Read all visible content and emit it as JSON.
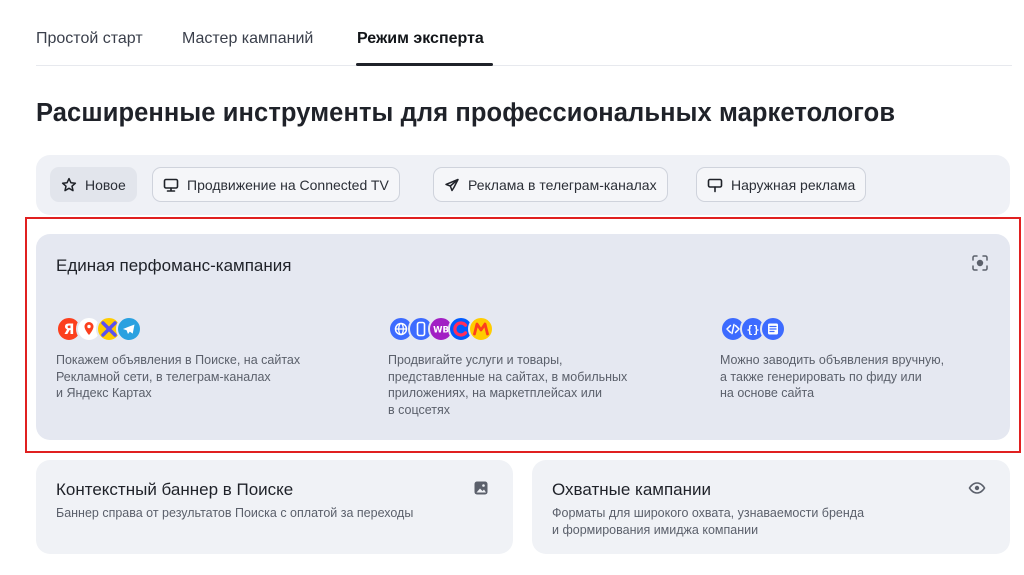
{
  "tabs": [
    {
      "label": "Простой старт"
    },
    {
      "label": "Мастер кампаний"
    },
    {
      "label": "Режим эксперта",
      "active": true
    }
  ],
  "title": "Расширенные инструменты для профессиональных маркетологов",
  "filters": [
    {
      "label": "Новое",
      "icon": "star-icon",
      "active": true
    },
    {
      "label": "Продвижение на Connected TV",
      "icon": "tv-icon"
    },
    {
      "label": "Реклама в телеграм-каналах",
      "icon": "telegram-plane-icon"
    },
    {
      "label": "Наружная реклама",
      "icon": "billboard-icon"
    }
  ],
  "performance": {
    "title": "Единая перфоманс-кампания",
    "icon": "focus-target-icon",
    "columns": [
      {
        "icons": [
          "yandex-icon",
          "maps-pin-icon",
          "network-icon",
          "telegram-icon"
        ],
        "lines": [
          "Покажем объявления в Поиске, на сайтах",
          "Рекламной сети, в телеграм-каналах",
          "и Яндекс Картах"
        ]
      },
      {
        "icons": [
          "globe-icon",
          "mobile-icon",
          "wb-icon",
          "ozon-icon",
          "market-icon"
        ],
        "lines": [
          "Продвигайте услуги и товары,",
          "представленные на сайтах, в мобильных",
          "приложениях, на маркетплейсах или",
          "в соцсетях"
        ]
      },
      {
        "icons": [
          "code-icon",
          "braces-icon",
          "list-icon"
        ],
        "lines": [
          "Можно заводить объявления вручную,",
          "а также генерировать по фиду или",
          "на основе сайта"
        ]
      }
    ]
  },
  "cards": [
    {
      "title": "Контекстный баннер в Поиске",
      "icon": "image-icon",
      "lines": [
        "Баннер справа от результатов Поиска с оплатой за переходы"
      ]
    },
    {
      "title": "Охватные кампании",
      "icon": "eye-icon",
      "lines": [
        "Форматы для широкого охвата, узнаваемости бренда",
        "и формирования имиджа компании"
      ]
    }
  ],
  "colors": {
    "highlight": "#e02020",
    "yandex_red": "#fc3f1d",
    "telegram_blue": "#2aa1e0",
    "web_blue": "#3d6bff",
    "wb_purple": "#a21fc4",
    "ozon_blue": "#005bff",
    "market_yellow": "#ffcc00"
  }
}
